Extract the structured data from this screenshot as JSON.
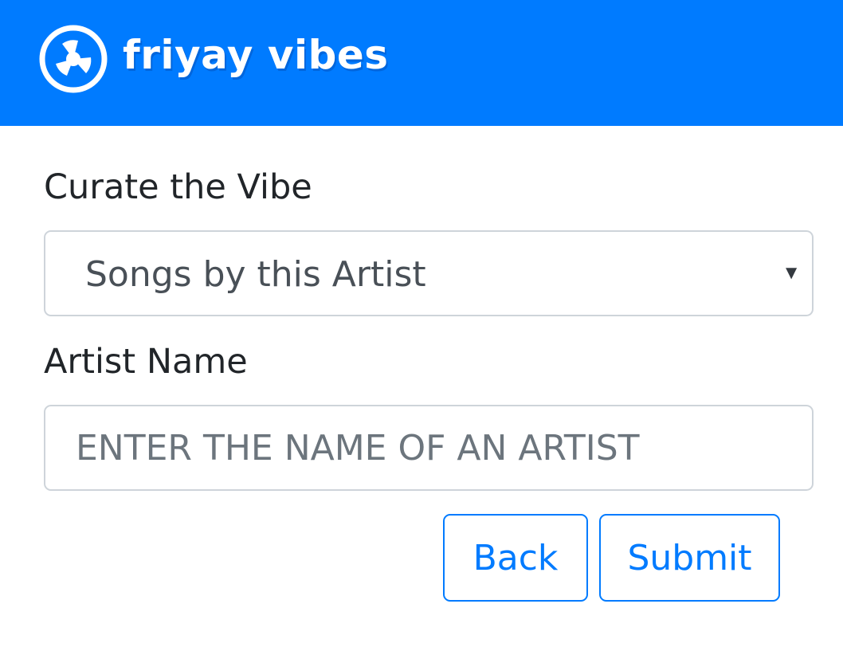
{
  "header": {
    "brand_name": "friyay vibes",
    "logo_icon": "radiation-disc-icon",
    "background_color": "#007bff"
  },
  "form": {
    "curate_label": "Curate the Vibe",
    "curate_select": {
      "selected_value": "Songs by this Artist",
      "caret_icon": "caret-down-icon"
    },
    "artist_label": "Artist Name",
    "artist_input": {
      "value": "",
      "placeholder": "ENTER THE NAME OF AN ARTIST"
    },
    "back_label": "Back",
    "submit_label": "Submit",
    "accent_color": "#007bff"
  }
}
